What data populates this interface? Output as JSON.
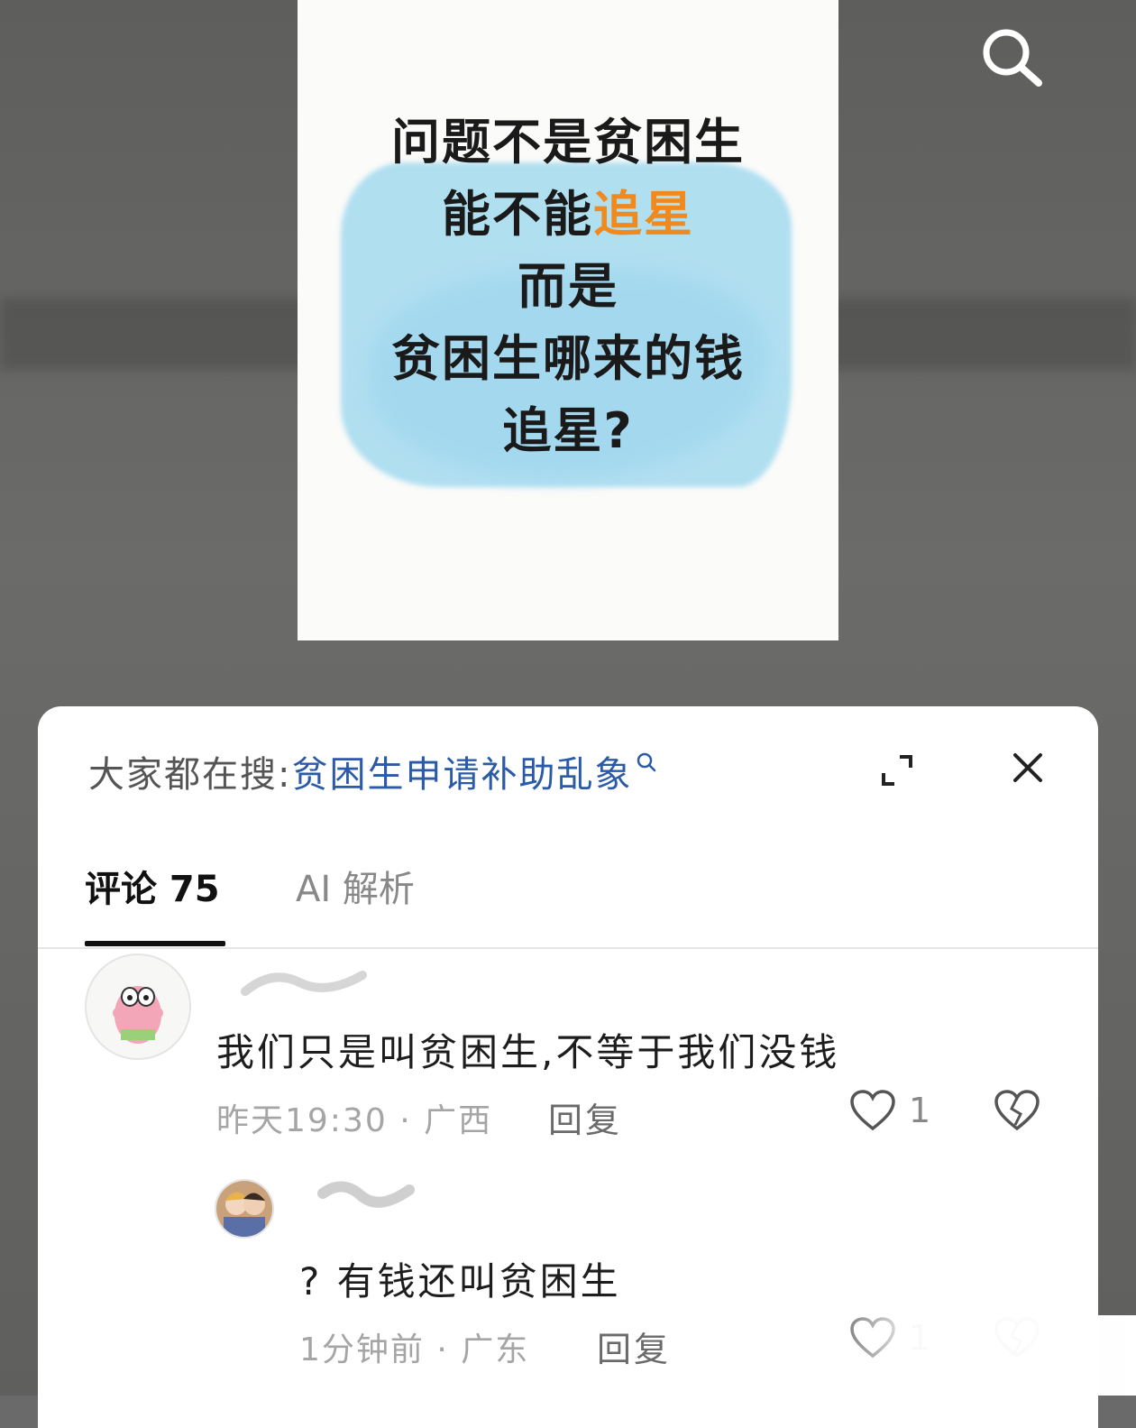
{
  "poster": {
    "line1": "问题不是贫困生",
    "line2a": "能不能",
    "line2b": "追星",
    "line3": "而是",
    "line4": "贫困生哪来的钱",
    "line5": "追星?"
  },
  "sheet": {
    "suggest_label": "大家都在搜:",
    "suggest_term": "贫困生申请补助乱象",
    "tabs": [
      {
        "label": "评论 75",
        "active": true
      },
      {
        "label": "AI 解析",
        "active": false
      }
    ]
  },
  "comments": [
    {
      "text": "我们只是叫贫困生,不等于我们没钱",
      "time": "昨天19:30",
      "location": "广西",
      "reply_label": "回复",
      "likes": "1"
    },
    {
      "text": "? 有钱还叫贫困生",
      "time": "1分钟前",
      "location": "广东",
      "reply_label": "回复",
      "likes": "1"
    }
  ],
  "colors": {
    "accent_orange": "#f08a1e",
    "link_blue": "#2a5aa8",
    "wash_blue": "#a8dcf0"
  },
  "icons": [
    "search-icon",
    "expand-icon",
    "close-icon",
    "heart-icon",
    "broken-heart-icon"
  ]
}
